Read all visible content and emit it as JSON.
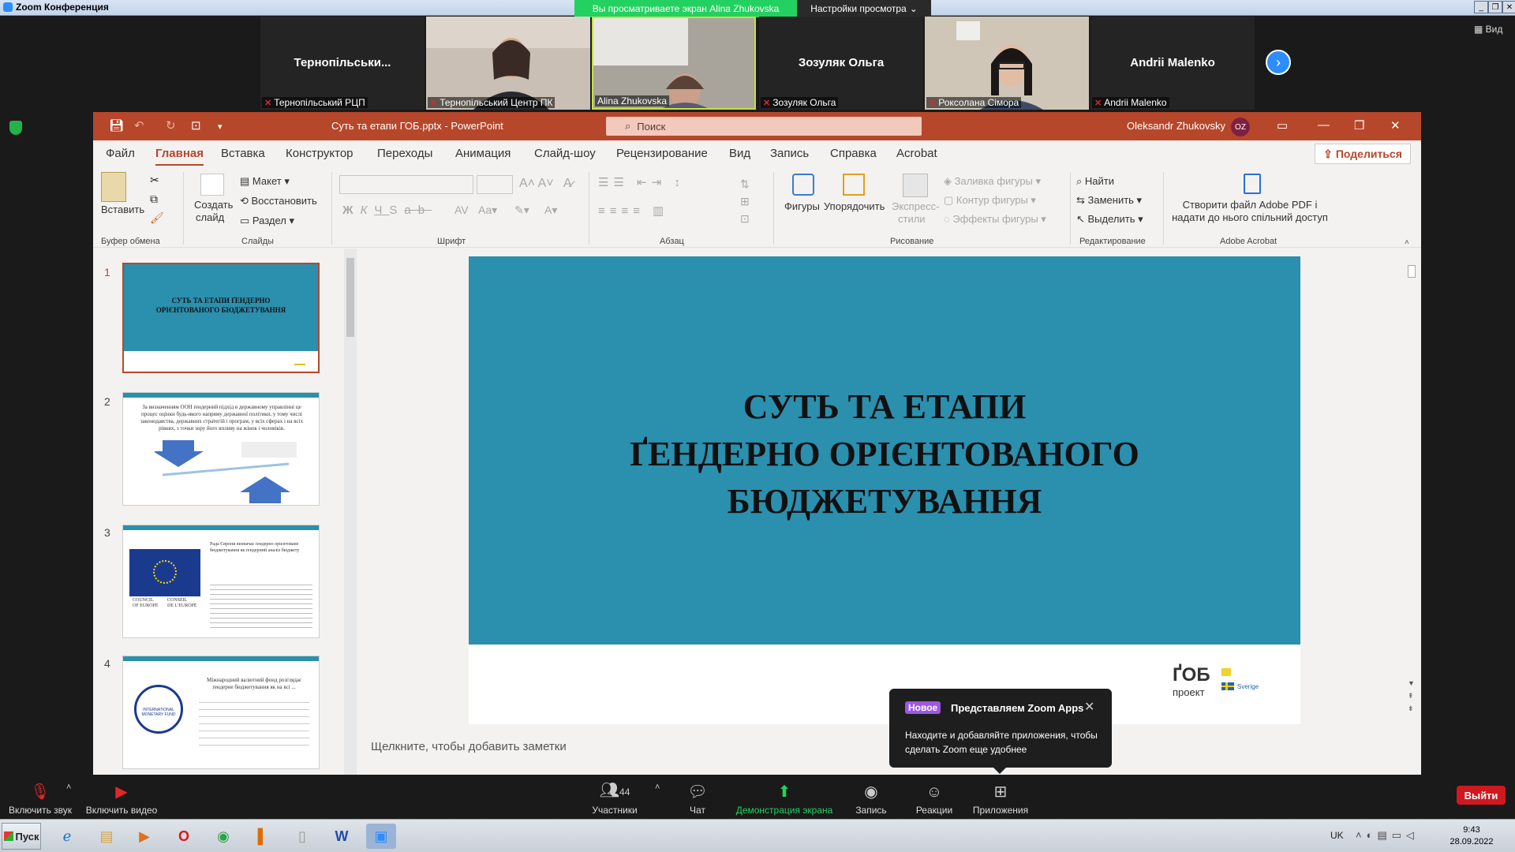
{
  "zoom": {
    "window_title": "Zoom Конференция",
    "share_banner": "Вы просматриваете экран Alina Zhukovska",
    "view_settings": "Настройки просмотра",
    "view_label": "Вид",
    "participants": [
      {
        "display": "Тернопільськи...",
        "caption": "Тернопільський РЦП",
        "video": false
      },
      {
        "display": "",
        "caption": "Тернопільський Центр ПК",
        "video": true
      },
      {
        "display": "",
        "caption": "Alina Zhukovska",
        "video": true
      },
      {
        "display": "Зозуляк Ольга",
        "caption": "Зозуляк Ольга",
        "video": false
      },
      {
        "display": "",
        "caption": "Роксолана Сімора",
        "video": true
      },
      {
        "display": "Andrii Malenko",
        "caption": "Andrii Malenko",
        "video": false
      }
    ],
    "toolbar": {
      "mute": "Включить звук",
      "video": "Включить видео",
      "participants": "Участники",
      "participants_count": "44",
      "chat": "Чат",
      "share": "Демонстрация экрана",
      "record": "Запись",
      "reactions": "Реакции",
      "apps": "Приложения",
      "leave": "Выйти"
    },
    "popup": {
      "badge": "Новое",
      "title": "Представляем Zoom Apps",
      "body": "Находите и добавляйте приложения, чтобы сделать Zoom еще удобнее"
    }
  },
  "powerpoint": {
    "file_title": "Суть та етапи ГОБ.pptx  -  PowerPoint",
    "search_placeholder": "Поиск",
    "user_name": "Oleksandr Zhukovsky",
    "user_initials": "OZ",
    "menu": [
      "Файл",
      "Главная",
      "Вставка",
      "Конструктор",
      "Переходы",
      "Анимация",
      "Слайд-шоу",
      "Рецензирование",
      "Вид",
      "Запись",
      "Справка",
      "Acrobat"
    ],
    "share": "Поделиться",
    "ribbon": {
      "clipboard": {
        "paste": "Вставить",
        "label": "Буфер обмена"
      },
      "slides": {
        "create": "Создать",
        "create2": "слайд",
        "layout": "Макет",
        "reset": "Восстановить",
        "section": "Раздел",
        "label": "Слайды"
      },
      "font": {
        "label": "Шрифт"
      },
      "paragraph": {
        "label": "Абзац"
      },
      "drawing": {
        "shapes": "Фигуры",
        "arrange": "Упорядочить",
        "quick": "Экспресс-",
        "quick2": "стили",
        "fill": "Заливка фигуры",
        "outline": "Контур фигуры",
        "effects": "Эффекты фигуры",
        "label": "Рисование"
      },
      "editing": {
        "find": "Найти",
        "replace": "Заменить",
        "select": "Выделить",
        "label": "Редактирование"
      },
      "acrobat": {
        "line1": "Створити файл Adobe PDF і",
        "line2": "надати до нього спільний доступ",
        "label": "Adobe Acrobat"
      }
    },
    "thumbnails": [
      {
        "num": "1",
        "text": "СУТЬ ТА ЕТАПИ ҐЕНДЕРНО ОРІЄНТОВАНОГО БЮДЖЕТУВАННЯ"
      },
      {
        "num": "2",
        "text": "За визначенням ООН ґендерний підхід в державному управлінні це процес оцінки будь-якого напряму державної політики, у тому числі законодавства, державних стратегій і програм, у всіх сферах і на всіх рівнях, з точки зору його впливу на жінок і чоловіків."
      },
      {
        "num": "3",
        "text": "Рада Європи визначає ґендерно орієнтоване бюджетування як ґендерний аналіз бюджету"
      },
      {
        "num": "4",
        "text": "Міжнародний валютний фонд розглядає ґендерне бюджетування як на всі ..."
      }
    ],
    "thumb3_logo": {
      "line1": "COUNCIL",
      "line2": "OF EUROPE",
      "line3": "CONSEIL",
      "line4": "DE L'EUROPE"
    },
    "thumb4_logo": "INTERNATIONAL MONETARY FUND",
    "slide": {
      "title_lines": [
        "СУТЬ ТА ЕТАПИ",
        "ҐЕНДЕРНО ОРІЄНТОВАНОГО",
        "БЮДЖЕТУВАННЯ"
      ],
      "logo_main": "ҐОБ",
      "logo_sub": "проект",
      "sweden": "Sverige"
    },
    "notes_placeholder": "Щелкните, чтобы добавить заметки"
  },
  "taskbar": {
    "start": "Пуск",
    "lang": "UK",
    "time": "9:43",
    "date": "28.09.2022"
  }
}
